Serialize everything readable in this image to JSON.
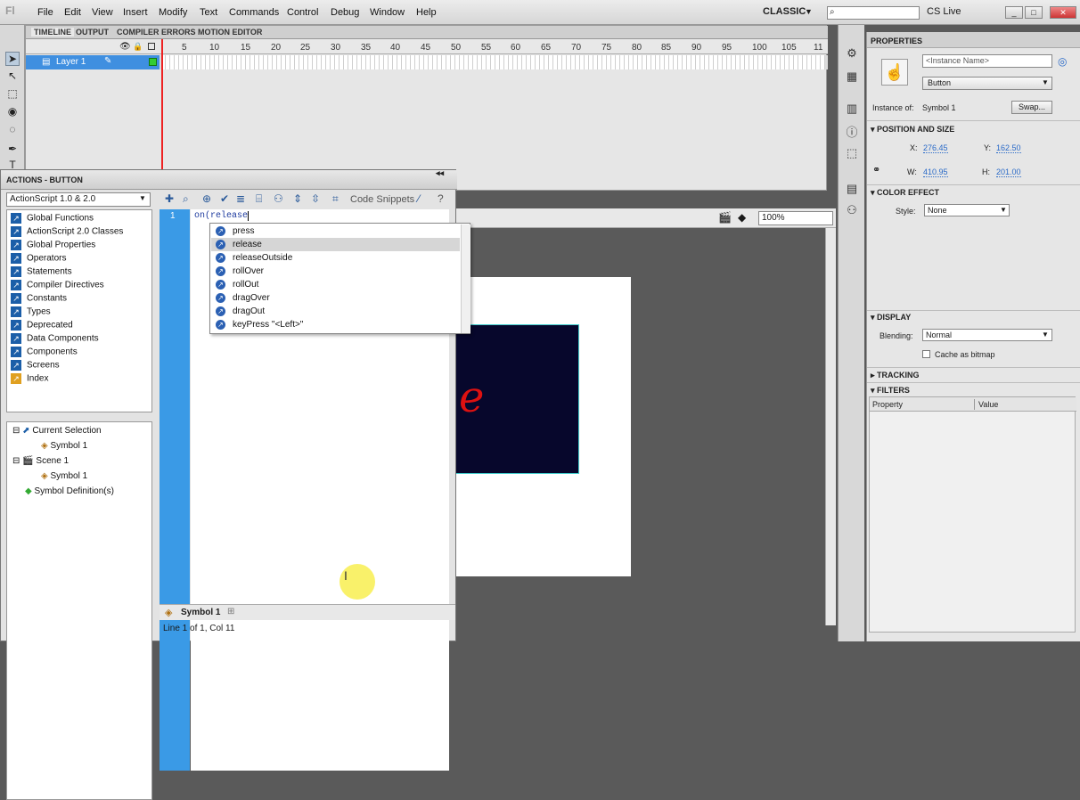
{
  "app": {
    "logo": "Fl"
  },
  "menu": [
    "File",
    "Edit",
    "View",
    "Insert",
    "Modify",
    "Text",
    "Commands",
    "Control",
    "Debug",
    "Window",
    "Help"
  ],
  "workspace": {
    "label": "CLASSIC",
    "search_placeholder": "",
    "cs_live": "CS Live"
  },
  "window_buttons": {
    "minimize": "_",
    "maximize": "□",
    "close": "✕"
  },
  "timeline": {
    "tabs": [
      "TIMELINE",
      "OUTPUT",
      "COMPILER ERRORS",
      "MOTION EDITOR"
    ],
    "frame_numbers": [
      "5",
      "10",
      "15",
      "20",
      "25",
      "30",
      "35",
      "40",
      "45",
      "50",
      "55",
      "60",
      "65",
      "70",
      "75",
      "80",
      "85",
      "90",
      "95",
      "100",
      "105",
      "11"
    ],
    "layer_name": "Layer 1"
  },
  "actions": {
    "title": "ACTIONS - BUTTON",
    "version": "ActionScript 1.0 & 2.0",
    "toolbox": [
      "Global Functions",
      "ActionScript 2.0 Classes",
      "Global Properties",
      "Operators",
      "Statements",
      "Compiler Directives",
      "Constants",
      "Types",
      "Deprecated",
      "Data Components",
      "Components",
      "Screens",
      "Index"
    ],
    "tree": {
      "current_selection": "Current Selection",
      "symbol_a": "Symbol 1",
      "scene": "Scene 1",
      "symbol_b": "Symbol 1",
      "symbol_defs": "Symbol Definition(s)"
    },
    "code_snippets": "Code Snippets",
    "line_number": "1",
    "code_keyword": "on",
    "code_rest": "(release",
    "autocomplete": [
      "press",
      "release",
      "releaseOutside",
      "rollOver",
      "rollOut",
      "dragOver",
      "dragOut",
      "keyPress \"<Left>\""
    ],
    "autocomplete_selected": "release",
    "script_tab": "Symbol 1",
    "status": "Line 1 of 1, Col 11"
  },
  "stage": {
    "zoom": "100%",
    "symbol_text": "e"
  },
  "properties": {
    "title": "PROPERTIES",
    "instance_name_placeholder": "<Instance Name>",
    "type": "Button",
    "instance_of_label": "Instance of:",
    "instance_of": "Symbol 1",
    "swap": "Swap...",
    "position_size": "POSITION AND SIZE",
    "x_label": "X:",
    "x": "276.45",
    "y_label": "Y:",
    "y": "162.50",
    "w_label": "W:",
    "w": "410.95",
    "h_label": "H:",
    "h": "201.00",
    "color_effect": "COLOR EFFECT",
    "style_label": "Style:",
    "style": "None",
    "display": "DISPLAY",
    "blending_label": "Blending:",
    "blending": "Normal",
    "cache_label": "Cache as bitmap",
    "tracking": "TRACKING",
    "filters": "FILTERS",
    "filters_cols": [
      "Property",
      "Value"
    ]
  }
}
